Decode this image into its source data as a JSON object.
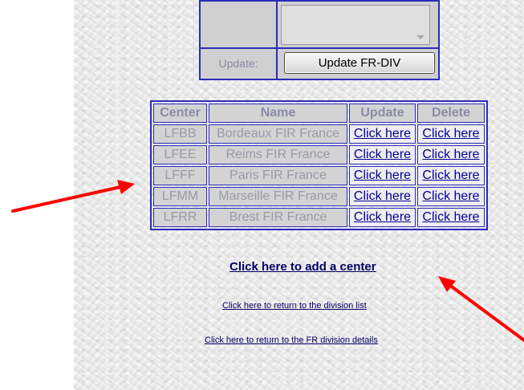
{
  "form": {
    "update_label": "Update:",
    "update_button": "Update FR-DIV"
  },
  "table": {
    "headers": [
      "Center",
      "Name",
      "Update",
      "Delete"
    ],
    "rows": [
      {
        "code": "LFBB",
        "name": "Bordeaux FIR France",
        "update": "Click here",
        "delete": "Click here"
      },
      {
        "code": "LFEE",
        "name": "Reims FIR France",
        "update": "Click here",
        "delete": "Click here"
      },
      {
        "code": "LFFF",
        "name": "Paris FIR France",
        "update": "Click here",
        "delete": "Click here"
      },
      {
        "code": "LFMM",
        "name": "Marseille FIR France",
        "update": "Click here",
        "delete": "Click here"
      },
      {
        "code": "LFRR",
        "name": "Brest FIR France",
        "update": "Click here",
        "delete": "Click here"
      }
    ]
  },
  "links": {
    "add_center": "Click here to add a center",
    "return_division_list": "Click here to return to the division list",
    "return_division_details": "Click here to return to the FR division details"
  },
  "colors": {
    "border": "#2b2bbb",
    "link": "#000099",
    "arrow": "#ff0000"
  }
}
